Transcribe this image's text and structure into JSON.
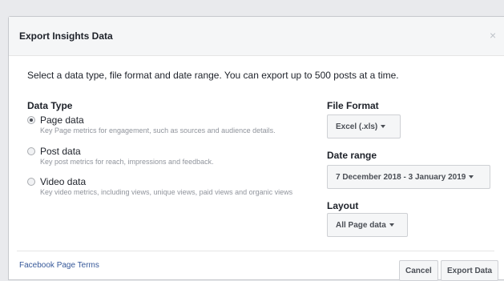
{
  "dialog": {
    "title": "Export Insights Data",
    "close_icon": "close-icon",
    "close_glyph": "×",
    "intro": "Select a data type, file format and date range. You can export up to 500 posts at a time."
  },
  "data_type": {
    "label": "Data Type",
    "options": [
      {
        "label": "Page data",
        "description": "Key Page metrics for engagement, such as sources and audience details.",
        "checked": true
      },
      {
        "label": "Post data",
        "description": "Key post metrics for reach, impressions and feedback.",
        "checked": false
      },
      {
        "label": "Video data",
        "description": "Key video metrics, including views, unique views, paid views and organic views",
        "checked": false
      }
    ]
  },
  "file_format": {
    "label": "File Format",
    "selected": "Excel (.xls)"
  },
  "date_range": {
    "label": "Date range",
    "selected": "7 December 2018 - 3 January 2019"
  },
  "layout": {
    "label": "Layout",
    "selected": "All Page data"
  },
  "footer": {
    "terms_link": "Facebook Page Terms",
    "cancel_label": "Cancel",
    "export_label": "Export Data"
  },
  "colors": {
    "link": "#365899",
    "header_bg": "#f5f6f7",
    "backdrop": "#e9eaed"
  }
}
